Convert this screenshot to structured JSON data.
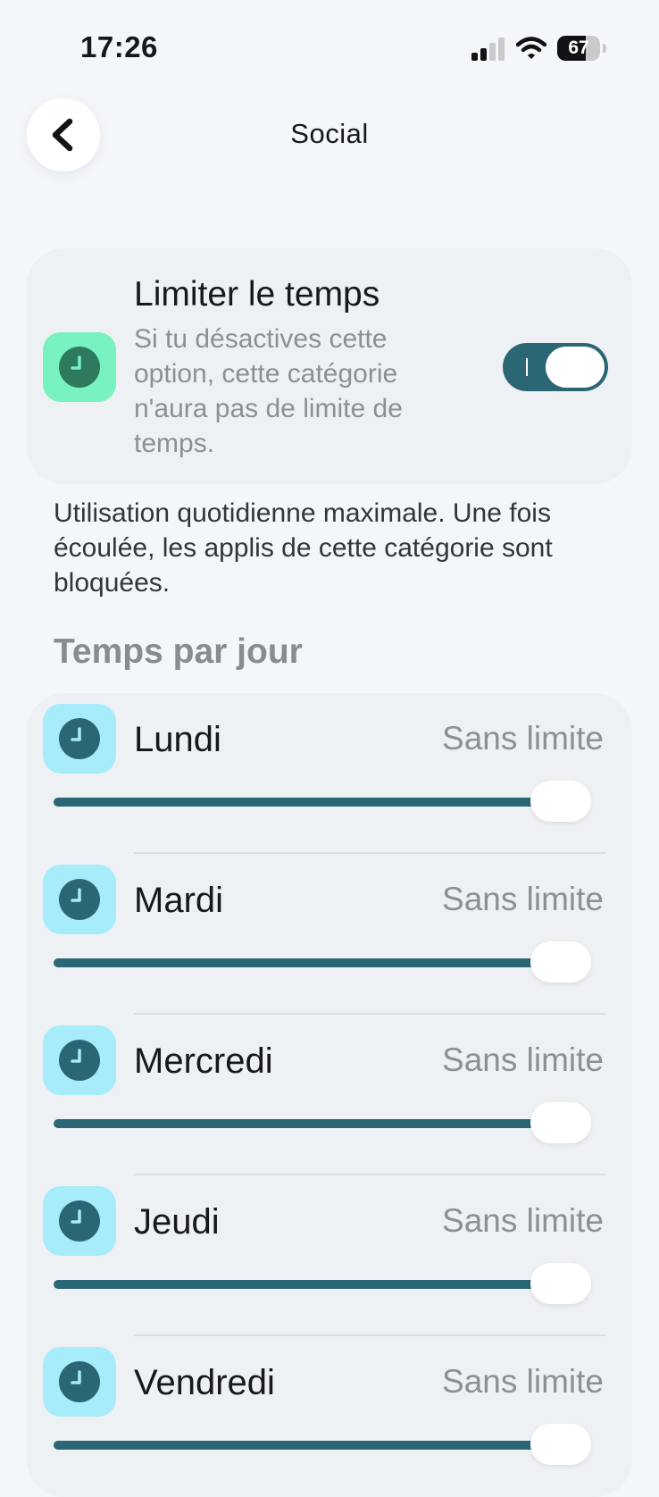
{
  "status_bar": {
    "time": "17:26",
    "battery": "67",
    "battery_level": 0.67,
    "signal_icon": "cellular-signal-icon",
    "wifi_icon": "wifi-icon"
  },
  "header": {
    "title": "Social",
    "back_icon": "chevron-left-icon"
  },
  "limit_card": {
    "title": "Limiter le temps",
    "description": "Si tu désactives cette option, cette catégorie n'aura pas de limite de temps.",
    "enabled": true,
    "icon": "clock-icon"
  },
  "daily_note": "Utilisation quotidienne maximale. Une fois écoulée, les applis de cette catégorie sont bloquées.",
  "section_title": "Temps par jour",
  "days": [
    {
      "name": "Lundi",
      "value": "Sans limite",
      "level": 1.0
    },
    {
      "name": "Mardi",
      "value": "Sans limite",
      "level": 1.0
    },
    {
      "name": "Mercredi",
      "value": "Sans limite",
      "level": 1.0
    },
    {
      "name": "Jeudi",
      "value": "Sans limite",
      "level": 1.0
    },
    {
      "name": "Vendredi",
      "value": "Sans limite",
      "level": 1.0
    }
  ],
  "colors": {
    "accent": "#2b6675",
    "limit_icon_bg": "#77f2c0",
    "day_icon_bg": "#a7ecfa",
    "card_bg": "#eef1f4",
    "page_bg": "#f4f7fa"
  }
}
